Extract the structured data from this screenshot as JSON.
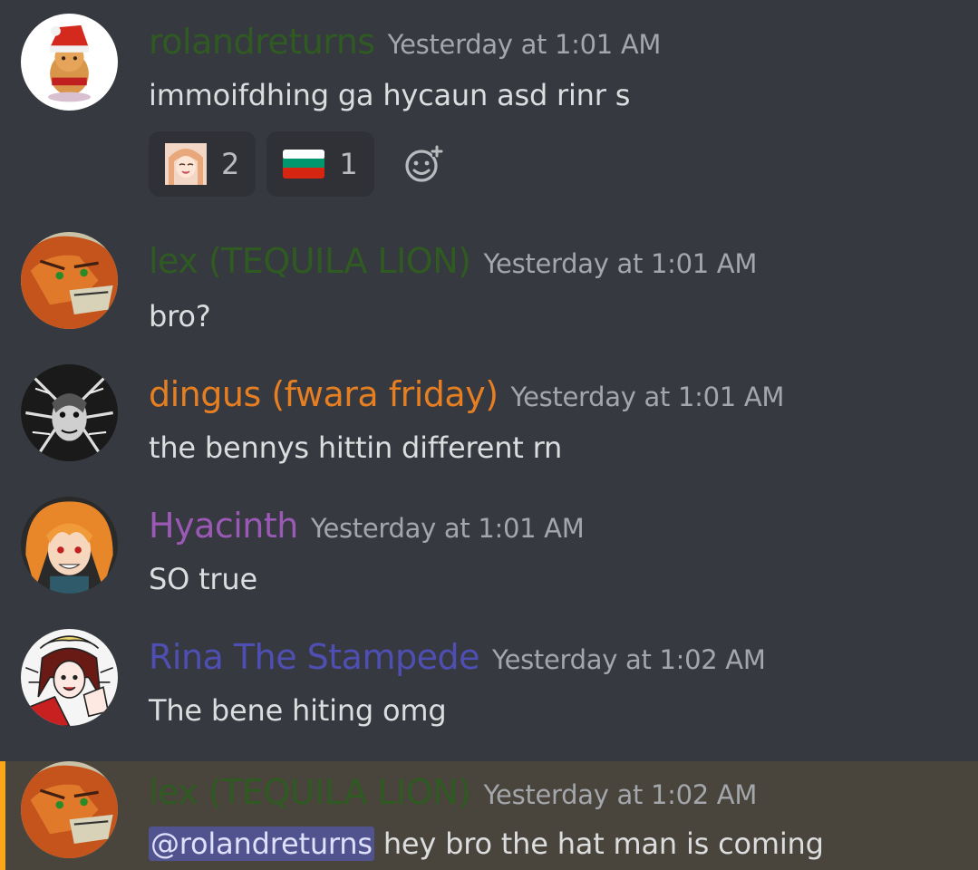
{
  "messages": [
    {
      "username": "rolandreturns",
      "name_color": "#2f5a22",
      "timestamp": "Yesterday at 1:01 AM",
      "text": "immoifdhing ga hycaun asd rinr s",
      "avatar": "christmas-hat-plush-avatar",
      "reactions": [
        {
          "emoji": "anime-girl-emoji",
          "count": "2"
        },
        {
          "emoji": "bulgaria-flag-emoji",
          "count": "1"
        }
      ]
    },
    {
      "username": "lex (TEQUILA LION)",
      "name_color": "#2f5a22",
      "timestamp": "Yesterday at 1:01 AM",
      "text": "bro?",
      "avatar": "orange-lion-avatar"
    },
    {
      "username": "dingus (fwara friday)",
      "name_color": "#e67e22",
      "timestamp": "Yesterday at 1:01 AM",
      "text": "the bennys hittin different rn",
      "avatar": "monochrome-sketch-avatar"
    },
    {
      "username": "Hyacinth",
      "name_color": "#9b59b6",
      "timestamp": "Yesterday at 1:01 AM",
      "text": "SO true",
      "avatar": "orange-hair-anime-avatar"
    },
    {
      "username": "Rina The Stampede",
      "name_color": "#4f4fb3",
      "timestamp": "Yesterday at 1:02 AM",
      "text": "The bene hiting omg",
      "avatar": "red-sketch-anime-avatar"
    },
    {
      "username": "lex (TEQUILA LION)",
      "name_color": "#2f5a22",
      "timestamp": "Yesterday at 1:02 AM",
      "mention": "@rolandreturns",
      "text": " hey bro the hat man is coming",
      "avatar": "orange-lion-avatar",
      "highlight_color": "#faa81a"
    }
  ]
}
